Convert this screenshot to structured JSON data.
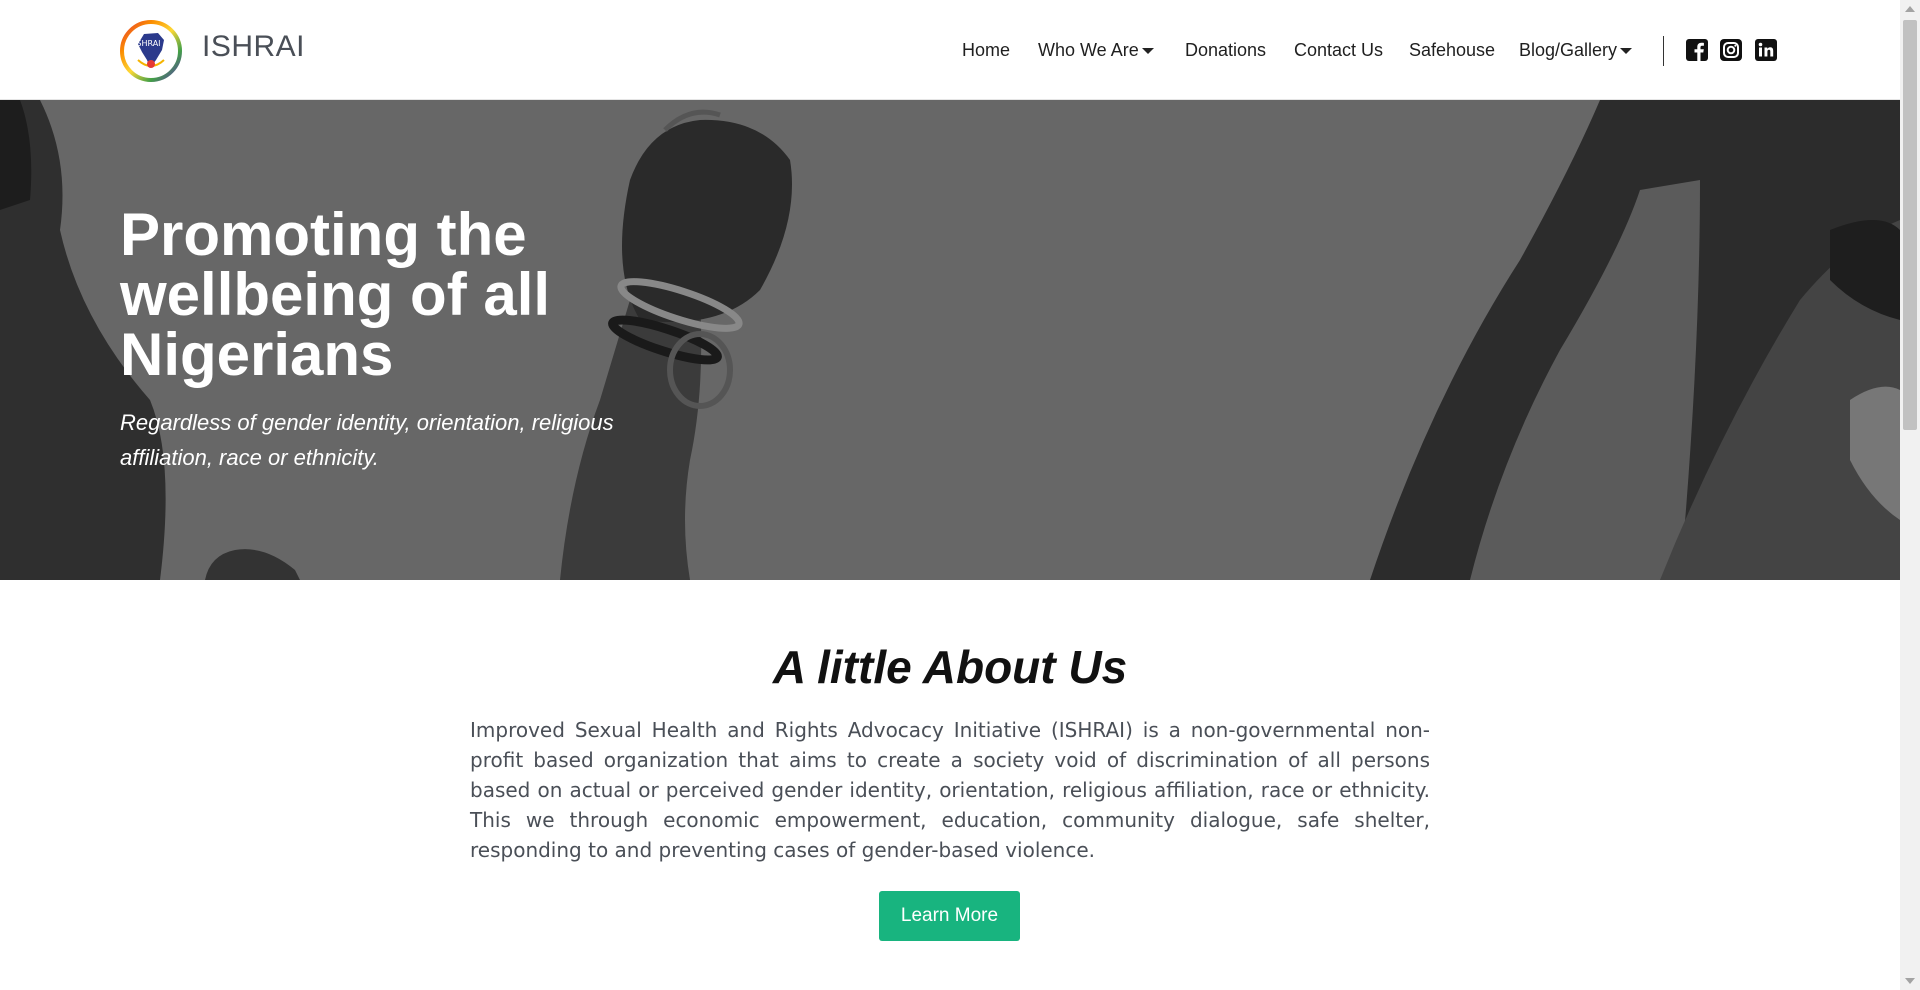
{
  "brand": {
    "name": "ISHRAI",
    "logo_text": "ISHRAI"
  },
  "nav": {
    "home": "Home",
    "who_we_are": "Who We Are",
    "donations": "Donations",
    "contact_us": "Contact Us",
    "safehouse": "Safehouse",
    "blog_gallery": "Blog/Gallery"
  },
  "social": [
    "facebook-icon",
    "instagram-icon",
    "linkedin-icon"
  ],
  "hero": {
    "title": "Promoting the wellbeing of all Nigerians",
    "subtitle": "Regardless of gender identity, orientation, religious affiliation, race or ethnicity."
  },
  "about": {
    "title": "A little About Us",
    "text": "Improved Sexual Health and Rights Advocacy Initiative (ISHRAI) is a non-governmental non-profit based organization that aims to create a society void of discrimination of all persons based on actual or perceived gender identity, orientation, religious affiliation, race or ethnicity. This we through economic empowerment, education, community dialogue, safe shelter, responding to and preventing cases of gender-based violence.",
    "button": "Learn More"
  },
  "colors": {
    "accent": "#18b47f",
    "hero_overlay": "#6a6a6a",
    "brand_text": "#4a4f57"
  }
}
